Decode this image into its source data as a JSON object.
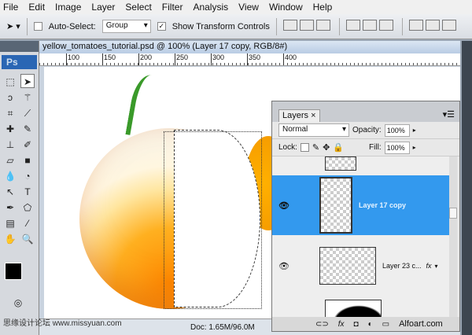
{
  "menu": [
    "File",
    "Edit",
    "Image",
    "Layer",
    "Select",
    "Filter",
    "Analysis",
    "View",
    "Window",
    "Help"
  ],
  "options": {
    "auto_select_label": "Auto-Select:",
    "auto_select_checked": false,
    "auto_select_value": "Group",
    "show_transform_label": "Show Transform Controls",
    "show_transform_checked": true
  },
  "toolbox": {
    "logo": "Ps"
  },
  "document": {
    "title": "yellow_tomatoes_tutorial.psd @ 100% (Layer 17 copy, RGB/8#)",
    "ruler": [
      "100",
      "150",
      "200",
      "250",
      "300",
      "350",
      "400"
    ],
    "status": "Doc: 1.65M/96.0M"
  },
  "layers_panel": {
    "tab": "Layers",
    "blend_mode": "Normal",
    "opacity_label": "Opacity:",
    "opacity": "100%",
    "lock_label": "Lock:",
    "fill_label": "Fill:",
    "fill": "100%",
    "layers": [
      {
        "name": "Layer 17 copy",
        "selected": true,
        "visible": true
      },
      {
        "name": "Layer 23 c...",
        "fx": "fx",
        "visible": true
      }
    ],
    "footer_fx": "fx"
  },
  "watermarks": {
    "left": "思缘设计论坛 www.missyuan.com",
    "right": "Alfoart.com"
  },
  "colors": {
    "accent": "#3399ee",
    "foreground": "#000000",
    "background": "#ffffff"
  }
}
